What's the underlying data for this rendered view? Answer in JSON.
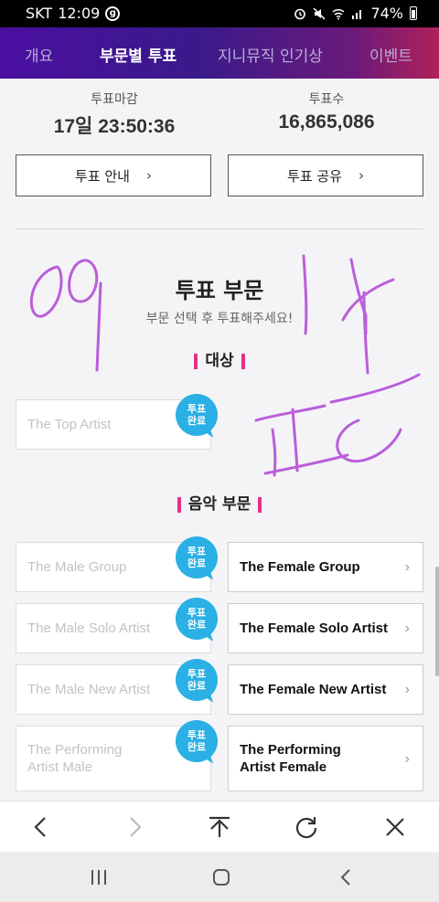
{
  "status_bar": {
    "carrier": "SKT",
    "time": "12:09",
    "battery": "74%"
  },
  "nav_tabs": [
    {
      "label": "개요"
    },
    {
      "label": "부문별 투표",
      "active": true
    },
    {
      "label": "지니뮤직 인기상"
    },
    {
      "label": "이벤트"
    }
  ],
  "vote_info": {
    "deadline_label": "투표마감",
    "deadline_value": "17일 23:50:36",
    "count_label": "투표수",
    "count_value": "16,865,086"
  },
  "buttons": {
    "guide": "투표 안내",
    "share": "투표 공유"
  },
  "section": {
    "title": "투표 부문",
    "subtitle": "부문 선택 후 투표해주세요!"
  },
  "badge_text": [
    "투표",
    "완료"
  ],
  "categories": {
    "grand": {
      "heading": "대상",
      "items": [
        {
          "label": "The Top Artist",
          "voted": true
        }
      ]
    },
    "music": {
      "heading": "음악 부문",
      "items": [
        {
          "label": "The Male Group",
          "voted": true
        },
        {
          "label": "The Female Group",
          "voted": false
        },
        {
          "label": "The Male Solo Artist",
          "voted": true
        },
        {
          "label": "The Female Solo Artist",
          "voted": false
        },
        {
          "label": "The Male New Artist",
          "voted": true
        },
        {
          "label": "The Female New Artist",
          "voted": false
        },
        {
          "label": "The Performing\nArtist Male",
          "voted": true
        },
        {
          "label": "The Performing\nArtist Female",
          "voted": false
        }
      ]
    }
  },
  "colors": {
    "accent_blue": "#2ab0e4",
    "accent_pink": "#e6308a",
    "scribble": "#b44ed8"
  },
  "browser_bar": [
    "back-icon",
    "forward-icon",
    "scroll-top-icon",
    "refresh-icon",
    "close-icon"
  ],
  "system_nav": [
    "recent-apps-icon",
    "home-icon",
    "back-icon"
  ]
}
